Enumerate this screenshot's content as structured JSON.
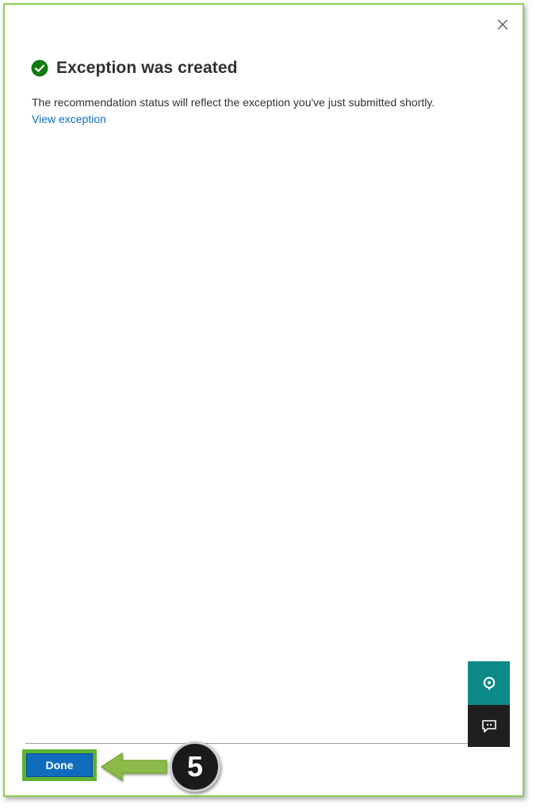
{
  "dialog": {
    "close_icon": "close-icon",
    "success_icon": "check-circle-icon",
    "title": "Exception was created",
    "message": "The recommendation status will reflect the exception you've just submitted shortly.",
    "link_label": "View exception"
  },
  "side_tools": {
    "help_icon": "help-support-icon",
    "feedback_icon": "feedback-chat-icon"
  },
  "footer": {
    "done_label": "Done"
  },
  "annotation": {
    "step_number": "5",
    "arrow_icon": "left-arrow-icon"
  },
  "colors": {
    "accent_blue": "#0f6cbd",
    "success_green": "#107c10",
    "highlight_green": "#5db233",
    "help_teal": "#0b8a8a"
  }
}
